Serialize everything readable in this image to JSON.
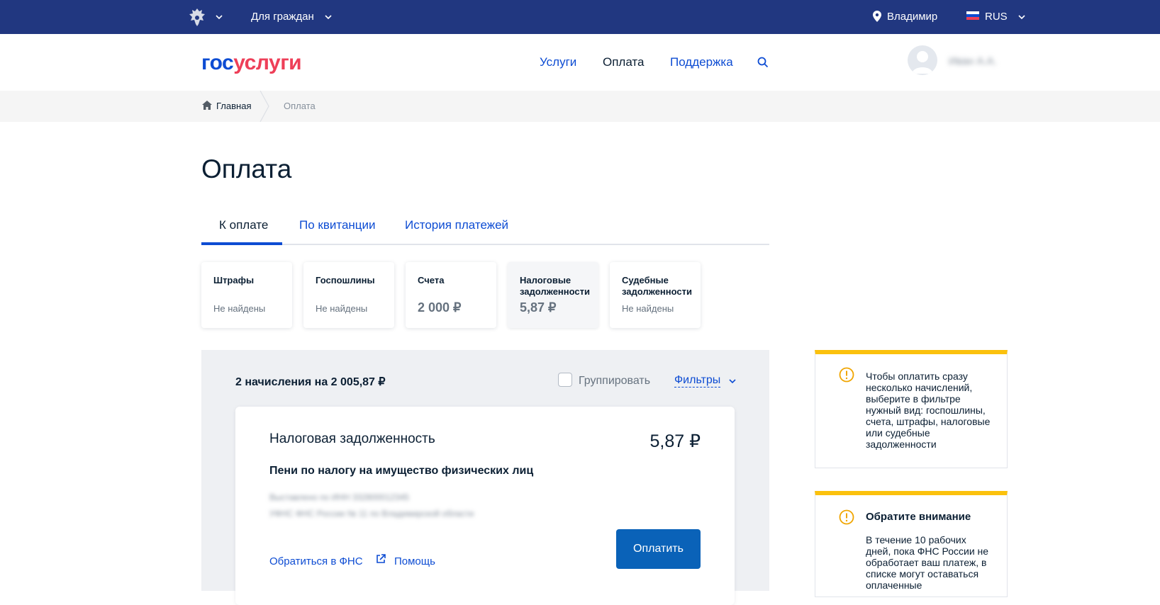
{
  "topbar": {
    "audience": "Для граждан",
    "city": "Владимир",
    "language": "RUS"
  },
  "header": {
    "logo_part1": "гос",
    "logo_part2": "услуги",
    "nav": [
      "Услуги",
      "Оплата",
      "Поддержка"
    ],
    "user_name": "Иван А.А."
  },
  "breadcrumbs": {
    "home": "Главная",
    "current": "Оплата"
  },
  "page": {
    "title": "Оплата",
    "tabs": [
      "К оплате",
      "По квитанции",
      "История платежей"
    ]
  },
  "categories": [
    {
      "title": "Штрафы",
      "value": "Не найдены"
    },
    {
      "title": "Госпошлины",
      "value": "Не найдены"
    },
    {
      "title": "Счета",
      "value": "2 000 ₽"
    },
    {
      "title": "Налоговые задолженности",
      "value": "5,87 ₽"
    },
    {
      "title": "Судебные задолженности",
      "value": "Не найдены"
    }
  ],
  "list": {
    "summary": "2 начисления на 2 005,87 ₽",
    "group_label": "Группировать",
    "filters_label": "Фильтры"
  },
  "debt": {
    "title": "Налоговая задолженность",
    "amount": "5,87 ₽",
    "subtitle": "Пени по налогу на имущество физических лиц",
    "detail_line1": "Выставлено по ИНН 332800012345",
    "detail_line2": "УФНС ФНС России № 11 по Владимирской области",
    "link_fns": "Обратиться в ФНС",
    "link_help": "Помощь",
    "pay_button": "Оплатить"
  },
  "notices": [
    {
      "heading": "",
      "text": "Чтобы оплатить сразу несколько начислений, выберите в фильтре нужный вид: госпошлины, счета, штрафы, налоговые или судебные задолженности"
    },
    {
      "heading": "Обратите внимание",
      "text": "В течение 10 рабочих дней, пока ФНС России не обработает ваш платеж, в списке могут оставаться оплаченные"
    }
  ],
  "colors": {
    "topbar": "#213780",
    "link": "#0d4cd3",
    "logo_red": "#ee3f58",
    "notice_accent": "#fbc10d",
    "pay_button": "#0a62b8"
  }
}
